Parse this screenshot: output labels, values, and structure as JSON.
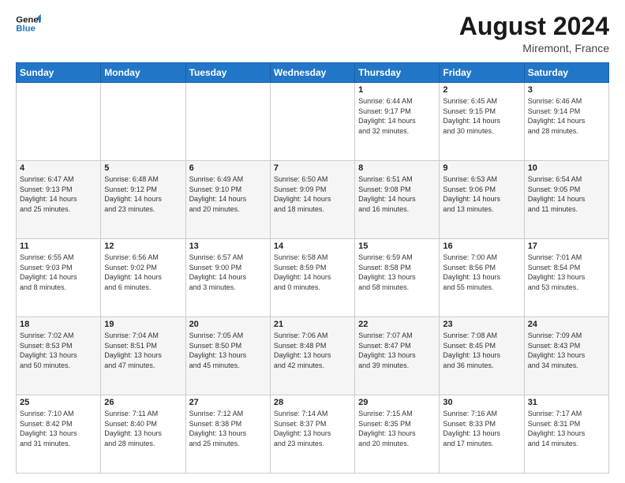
{
  "logo": {
    "line1": "General",
    "line2": "Blue"
  },
  "header": {
    "month_year": "August 2024",
    "location": "Miremont, France"
  },
  "weekdays": [
    "Sunday",
    "Monday",
    "Tuesday",
    "Wednesday",
    "Thursday",
    "Friday",
    "Saturday"
  ],
  "weeks": [
    [
      {
        "day": "",
        "info": ""
      },
      {
        "day": "",
        "info": ""
      },
      {
        "day": "",
        "info": ""
      },
      {
        "day": "",
        "info": ""
      },
      {
        "day": "1",
        "info": "Sunrise: 6:44 AM\nSunset: 9:17 PM\nDaylight: 14 hours\nand 32 minutes."
      },
      {
        "day": "2",
        "info": "Sunrise: 6:45 AM\nSunset: 9:15 PM\nDaylight: 14 hours\nand 30 minutes."
      },
      {
        "day": "3",
        "info": "Sunrise: 6:46 AM\nSunset: 9:14 PM\nDaylight: 14 hours\nand 28 minutes."
      }
    ],
    [
      {
        "day": "4",
        "info": "Sunrise: 6:47 AM\nSunset: 9:13 PM\nDaylight: 14 hours\nand 25 minutes."
      },
      {
        "day": "5",
        "info": "Sunrise: 6:48 AM\nSunset: 9:12 PM\nDaylight: 14 hours\nand 23 minutes."
      },
      {
        "day": "6",
        "info": "Sunrise: 6:49 AM\nSunset: 9:10 PM\nDaylight: 14 hours\nand 20 minutes."
      },
      {
        "day": "7",
        "info": "Sunrise: 6:50 AM\nSunset: 9:09 PM\nDaylight: 14 hours\nand 18 minutes."
      },
      {
        "day": "8",
        "info": "Sunrise: 6:51 AM\nSunset: 9:08 PM\nDaylight: 14 hours\nand 16 minutes."
      },
      {
        "day": "9",
        "info": "Sunrise: 6:53 AM\nSunset: 9:06 PM\nDaylight: 14 hours\nand 13 minutes."
      },
      {
        "day": "10",
        "info": "Sunrise: 6:54 AM\nSunset: 9:05 PM\nDaylight: 14 hours\nand 11 minutes."
      }
    ],
    [
      {
        "day": "11",
        "info": "Sunrise: 6:55 AM\nSunset: 9:03 PM\nDaylight: 14 hours\nand 8 minutes."
      },
      {
        "day": "12",
        "info": "Sunrise: 6:56 AM\nSunset: 9:02 PM\nDaylight: 14 hours\nand 6 minutes."
      },
      {
        "day": "13",
        "info": "Sunrise: 6:57 AM\nSunset: 9:00 PM\nDaylight: 14 hours\nand 3 minutes."
      },
      {
        "day": "14",
        "info": "Sunrise: 6:58 AM\nSunset: 8:59 PM\nDaylight: 14 hours\nand 0 minutes."
      },
      {
        "day": "15",
        "info": "Sunrise: 6:59 AM\nSunset: 8:58 PM\nDaylight: 13 hours\nand 58 minutes."
      },
      {
        "day": "16",
        "info": "Sunrise: 7:00 AM\nSunset: 8:56 PM\nDaylight: 13 hours\nand 55 minutes."
      },
      {
        "day": "17",
        "info": "Sunrise: 7:01 AM\nSunset: 8:54 PM\nDaylight: 13 hours\nand 53 minutes."
      }
    ],
    [
      {
        "day": "18",
        "info": "Sunrise: 7:02 AM\nSunset: 8:53 PM\nDaylight: 13 hours\nand 50 minutes."
      },
      {
        "day": "19",
        "info": "Sunrise: 7:04 AM\nSunset: 8:51 PM\nDaylight: 13 hours\nand 47 minutes."
      },
      {
        "day": "20",
        "info": "Sunrise: 7:05 AM\nSunset: 8:50 PM\nDaylight: 13 hours\nand 45 minutes."
      },
      {
        "day": "21",
        "info": "Sunrise: 7:06 AM\nSunset: 8:48 PM\nDaylight: 13 hours\nand 42 minutes."
      },
      {
        "day": "22",
        "info": "Sunrise: 7:07 AM\nSunset: 8:47 PM\nDaylight: 13 hours\nand 39 minutes."
      },
      {
        "day": "23",
        "info": "Sunrise: 7:08 AM\nSunset: 8:45 PM\nDaylight: 13 hours\nand 36 minutes."
      },
      {
        "day": "24",
        "info": "Sunrise: 7:09 AM\nSunset: 8:43 PM\nDaylight: 13 hours\nand 34 minutes."
      }
    ],
    [
      {
        "day": "25",
        "info": "Sunrise: 7:10 AM\nSunset: 8:42 PM\nDaylight: 13 hours\nand 31 minutes."
      },
      {
        "day": "26",
        "info": "Sunrise: 7:11 AM\nSunset: 8:40 PM\nDaylight: 13 hours\nand 28 minutes."
      },
      {
        "day": "27",
        "info": "Sunrise: 7:12 AM\nSunset: 8:38 PM\nDaylight: 13 hours\nand 25 minutes."
      },
      {
        "day": "28",
        "info": "Sunrise: 7:14 AM\nSunset: 8:37 PM\nDaylight: 13 hours\nand 23 minutes."
      },
      {
        "day": "29",
        "info": "Sunrise: 7:15 AM\nSunset: 8:35 PM\nDaylight: 13 hours\nand 20 minutes."
      },
      {
        "day": "30",
        "info": "Sunrise: 7:16 AM\nSunset: 8:33 PM\nDaylight: 13 hours\nand 17 minutes."
      },
      {
        "day": "31",
        "info": "Sunrise: 7:17 AM\nSunset: 8:31 PM\nDaylight: 13 hours\nand 14 minutes."
      }
    ]
  ]
}
